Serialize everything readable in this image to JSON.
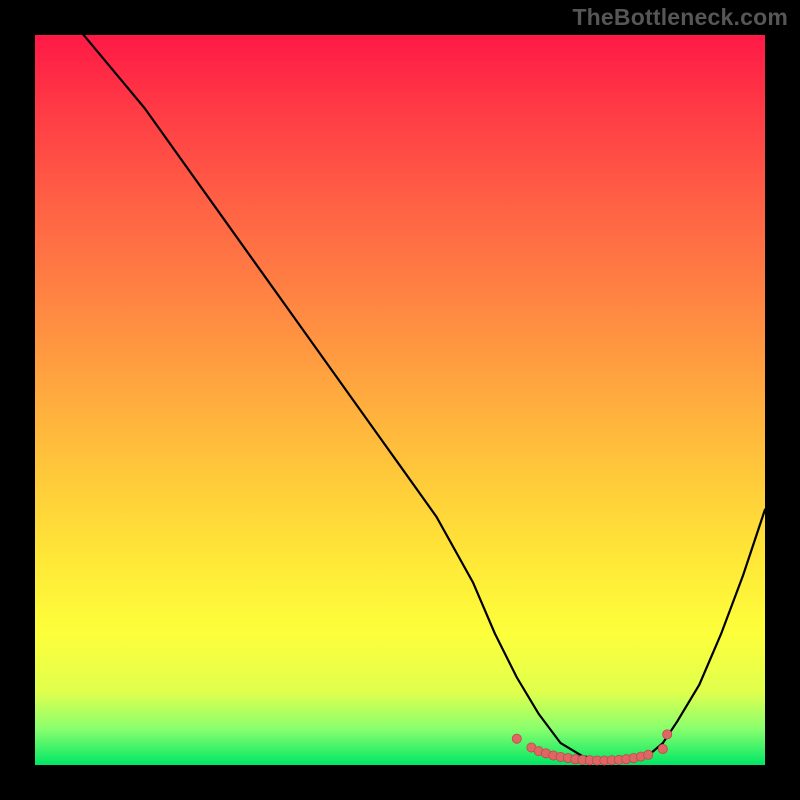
{
  "watermark": "TheBottleneck.com",
  "colors": {
    "frame_bg": "#000000",
    "line_stroke": "#000000",
    "marker_fill": "#e06666",
    "marker_stroke": "#c04848"
  },
  "chart_data": {
    "type": "line",
    "title": "",
    "xlabel": "",
    "ylabel": "",
    "xlim": [
      0,
      100
    ],
    "ylim": [
      0,
      100
    ],
    "grid": false,
    "legend": false,
    "series": [
      {
        "name": "curve",
        "x": [
          0,
          5,
          10,
          15,
          20,
          25,
          30,
          35,
          40,
          45,
          50,
          55,
          60,
          63,
          66,
          69,
          72,
          75,
          78,
          81,
          84,
          86,
          88,
          91,
          94,
          97,
          100
        ],
        "y": [
          108,
          102,
          96,
          90,
          83,
          76,
          69,
          62,
          55,
          48,
          41,
          34,
          25,
          18,
          12,
          7,
          3,
          1.2,
          0.7,
          0.7,
          1.3,
          3,
          6,
          11,
          18,
          26,
          35
        ]
      }
    ],
    "markers": {
      "name": "flat-region",
      "x": [
        66,
        68,
        69,
        70,
        71,
        72,
        73,
        74,
        75,
        76,
        77,
        78,
        79,
        80,
        81,
        82,
        83,
        84,
        86,
        86.6
      ],
      "y": [
        3.6,
        2.4,
        1.9,
        1.6,
        1.3,
        1.1,
        0.95,
        0.8,
        0.7,
        0.65,
        0.62,
        0.62,
        0.65,
        0.7,
        0.8,
        0.95,
        1.15,
        1.4,
        2.2,
        4.2
      ]
    }
  }
}
